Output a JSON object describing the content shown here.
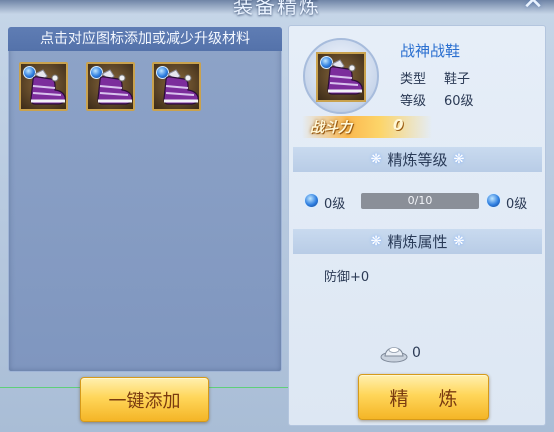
{
  "window": {
    "title": "装备精炼",
    "close_icon": "close-x-icon"
  },
  "materials": {
    "instruction": "点击对应图标添加或减少升级材料",
    "slots": [
      {
        "icon": "boot-icon",
        "gem_icon": "blue-gem-icon"
      },
      {
        "icon": "boot-icon",
        "gem_icon": "blue-gem-icon"
      },
      {
        "icon": "boot-icon",
        "gem_icon": "blue-gem-icon"
      }
    ],
    "add_all_label": "一键添加"
  },
  "item": {
    "name": "战神战鞋",
    "type_key": "类型",
    "type_value": "鞋子",
    "level_key": "等级",
    "level_value": "60级",
    "power_label": "战斗力",
    "power_value": "0",
    "name_color": "#2a6fd0"
  },
  "refine_level": {
    "title": "精炼等级",
    "current": "0级",
    "next": "0级",
    "progress_text": "0/10",
    "progress_fraction": 0
  },
  "refine_attr": {
    "title": "精炼属性",
    "text": "防御+0"
  },
  "cost": {
    "currency_icon": "silver-ingot-icon",
    "amount": "0"
  },
  "refine_button_label": "精 炼",
  "colors": {
    "button_gold": "#ffd65a",
    "header_blue": "#5f7db4",
    "accent_blue": "#2a6fd0"
  }
}
